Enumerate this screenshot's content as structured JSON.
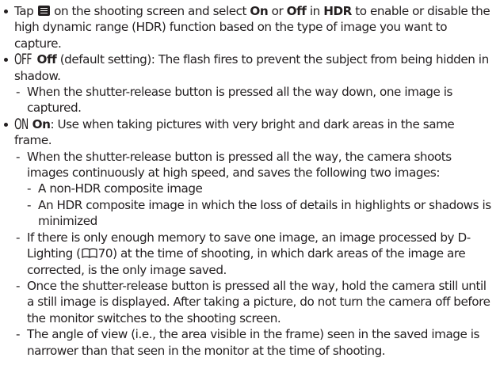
{
  "intro": {
    "part1": "Tap",
    "part2": "on the shooting screen and select",
    "on": "On",
    "or": "or",
    "off": "Off",
    "in": "in",
    "hdr": "HDR",
    "part3": "to enable or disable the high dynamic range (HDR) function based on the type of image you want to capture."
  },
  "off_item": {
    "icon_text": "OFF",
    "label": "Off",
    "desc": "(default setting): The flash fires to prevent the subject from being hidden in shadow.",
    "sub": "When the shutter-release button is pressed all the way down, one image is captured."
  },
  "on_item": {
    "icon_text": "ON",
    "label": "On",
    "desc": ": Use when taking pictures with very bright and dark areas in the same frame.",
    "sub1": "When the shutter-release button is pressed all the way, the camera shoots images continuously at high speed, and saves the following two images:",
    "subsub1": "A non-HDR composite image",
    "subsub2": "An HDR composite image in which the loss of details in highlights or shadows is minimized",
    "sub2_part1": "If there is only enough memory to save one image, an image processed by D-Lighting (",
    "sub2_ref": "70",
    "sub2_part2": ") at the time of shooting, in which dark areas of the image are corrected, is the only image saved.",
    "sub3": "Once the shutter-release button is pressed all the way, hold the camera still until a still image is displayed. After taking a picture, do not turn the camera off before the monitor switches to the shooting screen.",
    "sub4": "The angle of view (i.e., the area visible in the frame) seen in the saved image is narrower than that seen in the monitor at the time of shooting."
  }
}
